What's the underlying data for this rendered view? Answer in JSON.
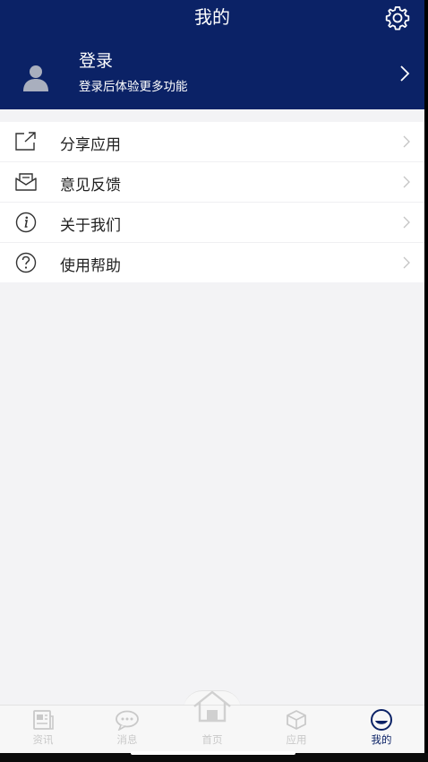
{
  "header": {
    "title": "我的",
    "login_title": "登录",
    "login_subtitle": "登录后体验更多功能"
  },
  "menu": {
    "items": [
      {
        "label": "分享应用",
        "icon": "share-icon"
      },
      {
        "label": "意见反馈",
        "icon": "feedback-icon"
      },
      {
        "label": "关于我们",
        "icon": "info-icon"
      },
      {
        "label": "使用帮助",
        "icon": "help-icon"
      }
    ]
  },
  "tabbar": {
    "items": [
      {
        "label": "资讯",
        "icon": "news-icon"
      },
      {
        "label": "消息",
        "icon": "message-icon"
      },
      {
        "label": "首页",
        "icon": "home-icon"
      },
      {
        "label": "应用",
        "icon": "apps-icon"
      },
      {
        "label": "我的",
        "icon": "profile-icon"
      }
    ],
    "active_index": 4
  },
  "colors": {
    "brand": "#0b2266",
    "background": "#f3f3f5",
    "tab_inactive": "#c9c9c9"
  }
}
